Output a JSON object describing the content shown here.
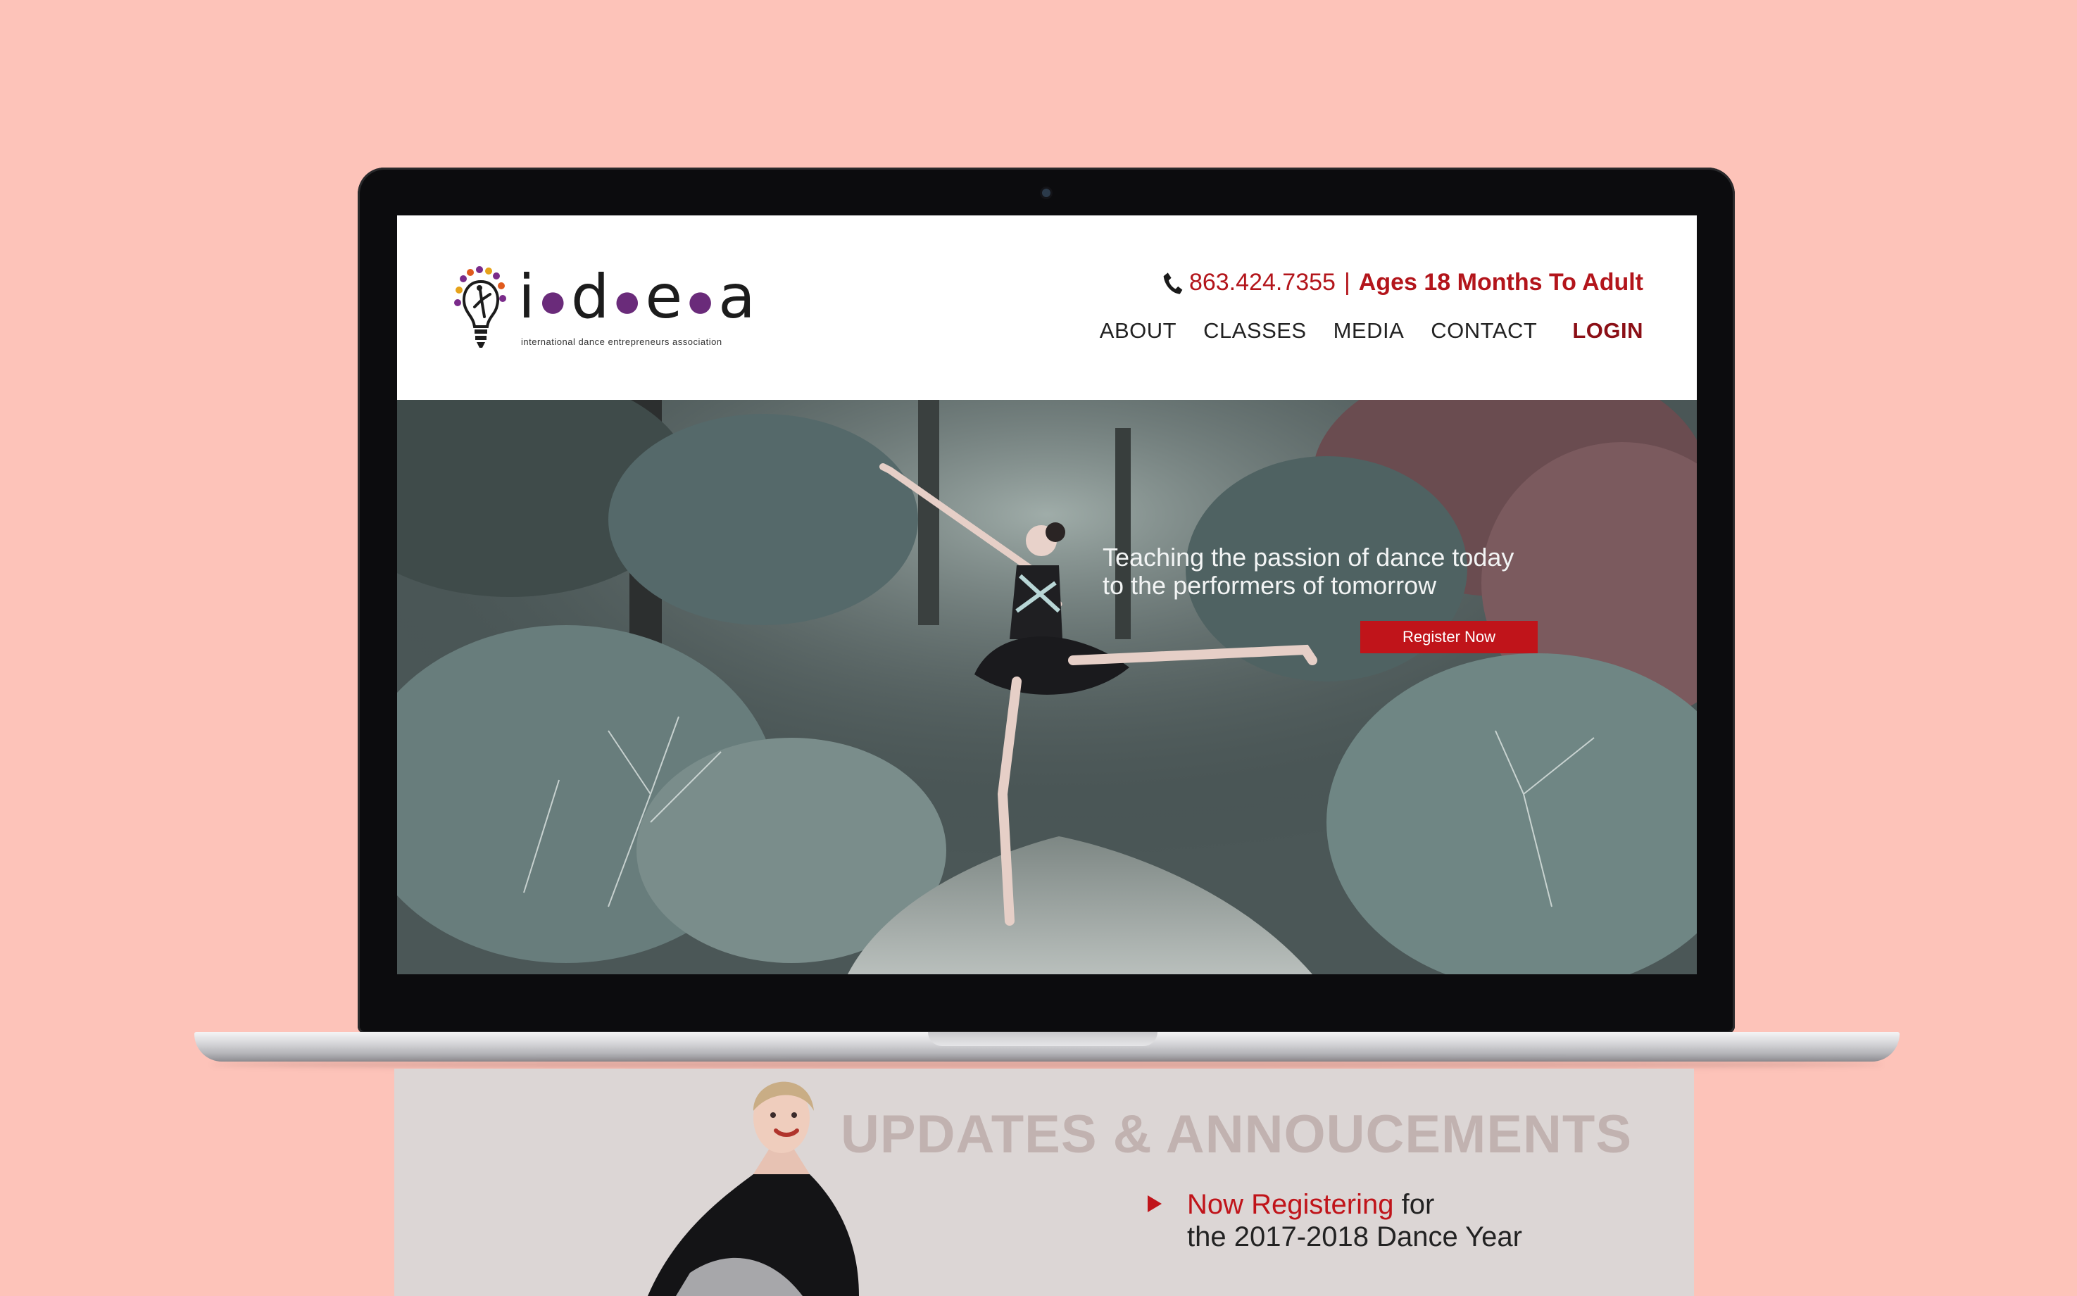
{
  "header": {
    "logo_word": [
      "i",
      "d",
      "e",
      "a"
    ],
    "logo_tagline": "international dance entrepreneurs association",
    "phone": "863.424.7355",
    "separator": "|",
    "ages": "Ages 18 Months To Adult"
  },
  "nav": {
    "items": [
      "ABOUT",
      "CLASSES",
      "MEDIA",
      "CONTACT"
    ],
    "login": "LOGIN"
  },
  "hero": {
    "line1": "Teaching the passion of dance today",
    "line2": "to the performers of tomorrow",
    "cta": "Register Now"
  },
  "updates": {
    "title": "UPDATES & ANNOUCEMENTS",
    "item_highlight": "Now Registering",
    "item_rest": " for",
    "item_line2": "the 2017-2018 Dance Year"
  },
  "colors": {
    "background": "#fdc3b9",
    "brand_red": "#c0141a",
    "login_red": "#8b0f16",
    "logo_purple": "#6a2b7a"
  }
}
